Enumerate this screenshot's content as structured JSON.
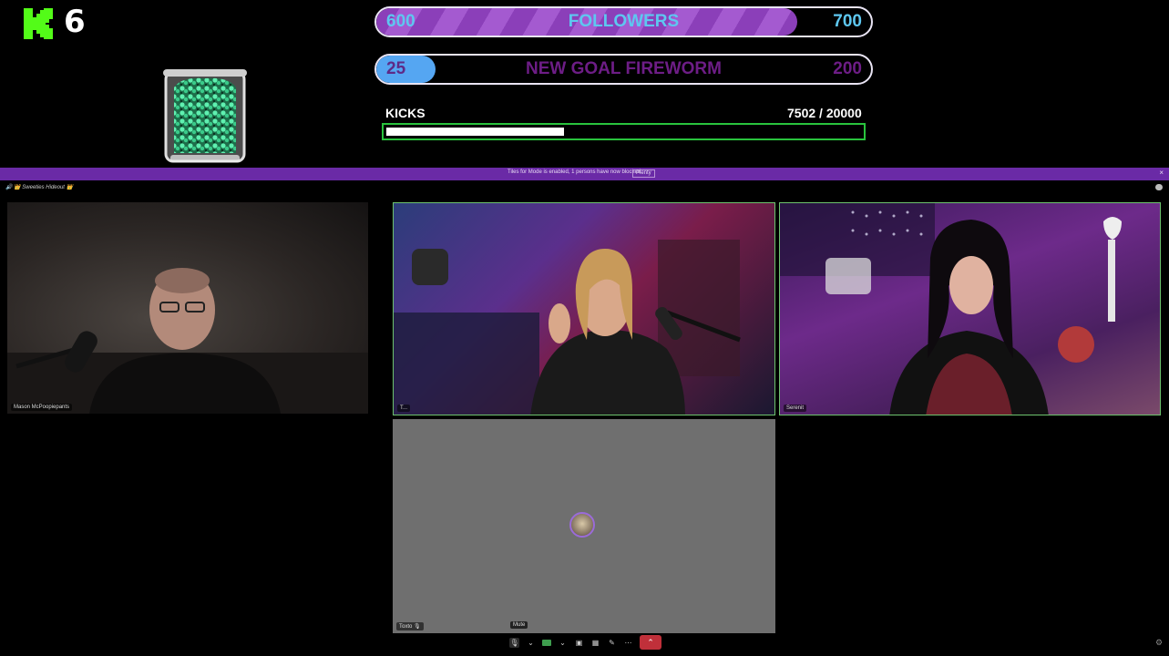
{
  "kick_counter": {
    "count": "6",
    "logo_color": "#53fc18"
  },
  "goals": [
    {
      "start": "600",
      "title": "FOLLOWERS",
      "end": "700",
      "progress_fraction": 0.85
    },
    {
      "start": "25",
      "title": "NEW GOAL FIREWORM",
      "end": "200",
      "progress_fraction": 0.12
    }
  ],
  "kicks": {
    "label": "KICKS",
    "value": "7502  / 20000",
    "progress_fraction": 0.375
  },
  "notice": {
    "text": "Tiles for Mode is enabled, 1 persons have now blocked.",
    "link": "Plenty",
    "close": "×"
  },
  "meeting": {
    "title": "🔊 👑 Sweeties Hideout 👑"
  },
  "participants": {
    "mason": "Mason McPoopiepants",
    "center": "T...",
    "serenity": "Serenit",
    "toxto": "Toxto 🎙"
  },
  "controls": {
    "tooltip": "Mute"
  },
  "colors": {
    "accent": "#6a2aa6",
    "tile_border": "#6ec36e",
    "leave": "#c0303a"
  }
}
